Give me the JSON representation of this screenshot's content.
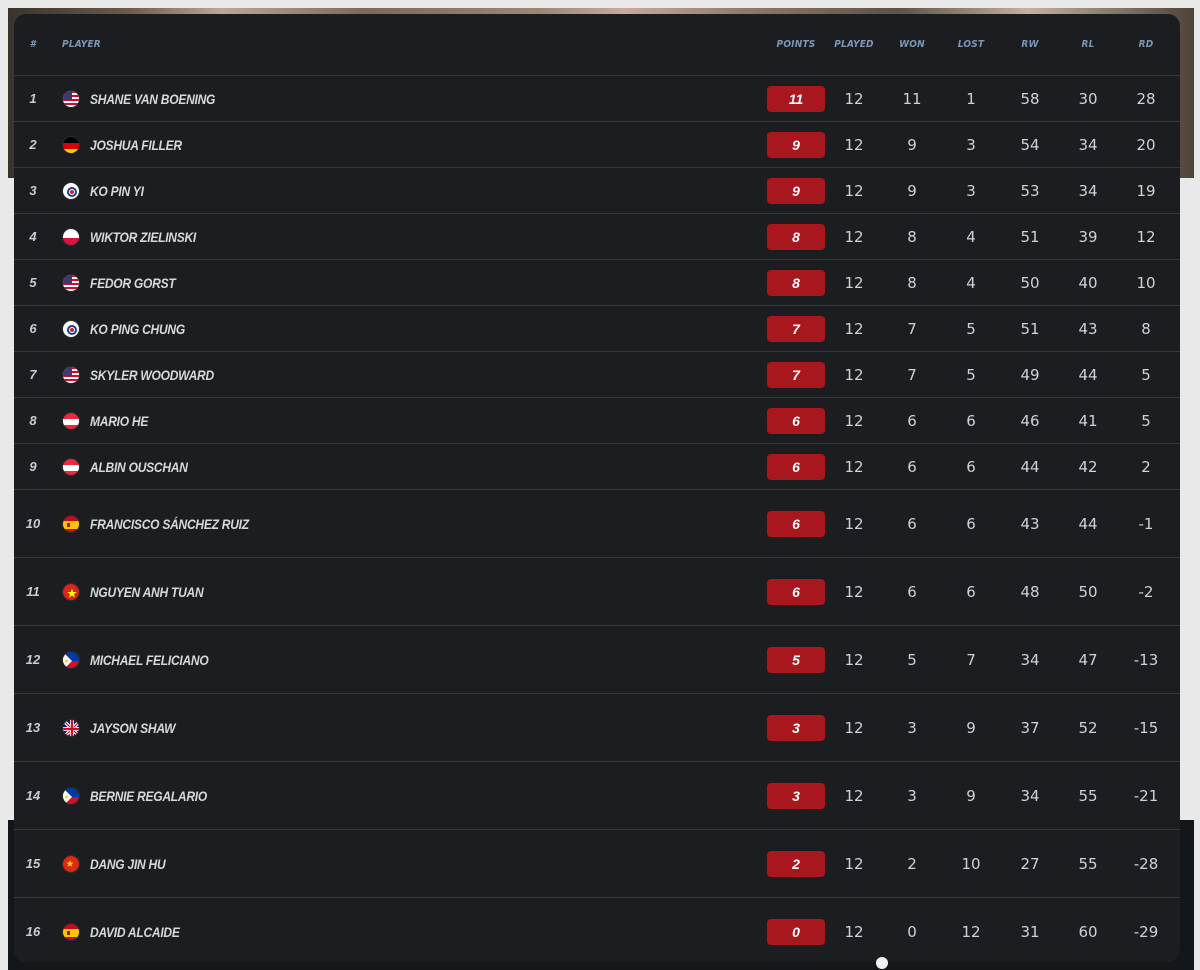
{
  "headers": {
    "rank": "#",
    "player": "PLAYER",
    "points": "POINTS",
    "played": "PLAYED",
    "won": "WON",
    "lost": "LOST",
    "rw": "RW",
    "rl": "RL",
    "rd": "RD"
  },
  "colors": {
    "points_badge": "#a8171d",
    "header_text": "#7d97b8",
    "card_bg": "#1b1d20"
  },
  "rows": [
    {
      "rank": "1",
      "flag": "usa-flag-icon",
      "name": "SHANE VAN BOENING",
      "points": "11",
      "played": "12",
      "won": "11",
      "lost": "1",
      "rw": "58",
      "rl": "30",
      "rd": "28"
    },
    {
      "rank": "2",
      "flag": "germany-flag-icon",
      "name": "JOSHUA FILLER",
      "points": "9",
      "played": "12",
      "won": "9",
      "lost": "3",
      "rw": "54",
      "rl": "34",
      "rd": "20"
    },
    {
      "rank": "3",
      "flag": "chinese-taipei-flag-icon",
      "name": "KO PIN YI",
      "points": "9",
      "played": "12",
      "won": "9",
      "lost": "3",
      "rw": "53",
      "rl": "34",
      "rd": "19"
    },
    {
      "rank": "4",
      "flag": "poland-flag-icon",
      "name": "WIKTOR ZIELINSKI",
      "points": "8",
      "played": "12",
      "won": "8",
      "lost": "4",
      "rw": "51",
      "rl": "39",
      "rd": "12"
    },
    {
      "rank": "5",
      "flag": "usa-flag-icon",
      "name": "FEDOR GORST",
      "points": "8",
      "played": "12",
      "won": "8",
      "lost": "4",
      "rw": "50",
      "rl": "40",
      "rd": "10"
    },
    {
      "rank": "6",
      "flag": "chinese-taipei-flag-icon",
      "name": "KO PING CHUNG",
      "points": "7",
      "played": "12",
      "won": "7",
      "lost": "5",
      "rw": "51",
      "rl": "43",
      "rd": "8"
    },
    {
      "rank": "7",
      "flag": "usa-flag-icon",
      "name": "SKYLER WOODWARD",
      "points": "7",
      "played": "12",
      "won": "7",
      "lost": "5",
      "rw": "49",
      "rl": "44",
      "rd": "5"
    },
    {
      "rank": "8",
      "flag": "austria-flag-icon",
      "name": "MARIO HE",
      "points": "6",
      "played": "12",
      "won": "6",
      "lost": "6",
      "rw": "46",
      "rl": "41",
      "rd": "5"
    },
    {
      "rank": "9",
      "flag": "austria-flag-icon",
      "name": "ALBIN OUSCHAN",
      "points": "6",
      "played": "12",
      "won": "6",
      "lost": "6",
      "rw": "44",
      "rl": "42",
      "rd": "2"
    },
    {
      "rank": "10",
      "flag": "spain-flag-icon",
      "name": "FRANCISCO SÁNCHEZ RUIZ",
      "points": "6",
      "played": "12",
      "won": "6",
      "lost": "6",
      "rw": "43",
      "rl": "44",
      "rd": "-1"
    },
    {
      "rank": "11",
      "flag": "vietnam-flag-icon",
      "name": "NGUYEN ANH TUAN",
      "points": "6",
      "played": "12",
      "won": "6",
      "lost": "6",
      "rw": "48",
      "rl": "50",
      "rd": "-2"
    },
    {
      "rank": "12",
      "flag": "philippines-flag-icon",
      "name": "MICHAEL FELICIANO",
      "points": "5",
      "played": "12",
      "won": "5",
      "lost": "7",
      "rw": "34",
      "rl": "47",
      "rd": "-13"
    },
    {
      "rank": "13",
      "flag": "uk-flag-icon",
      "name": "JAYSON SHAW",
      "points": "3",
      "played": "12",
      "won": "3",
      "lost": "9",
      "rw": "37",
      "rl": "52",
      "rd": "-15"
    },
    {
      "rank": "14",
      "flag": "philippines-flag-icon",
      "name": "BERNIE REGALARIO",
      "points": "3",
      "played": "12",
      "won": "3",
      "lost": "9",
      "rw": "34",
      "rl": "55",
      "rd": "-21"
    },
    {
      "rank": "15",
      "flag": "china-flag-icon",
      "name": "DANG JIN HU",
      "points": "2",
      "played": "12",
      "won": "2",
      "lost": "10",
      "rw": "27",
      "rl": "55",
      "rd": "-28"
    },
    {
      "rank": "16",
      "flag": "spain-flag-icon",
      "name": "DAVID ALCAIDE",
      "points": "0",
      "played": "12",
      "won": "0",
      "lost": "12",
      "rw": "31",
      "rl": "60",
      "rd": "-29"
    }
  ]
}
